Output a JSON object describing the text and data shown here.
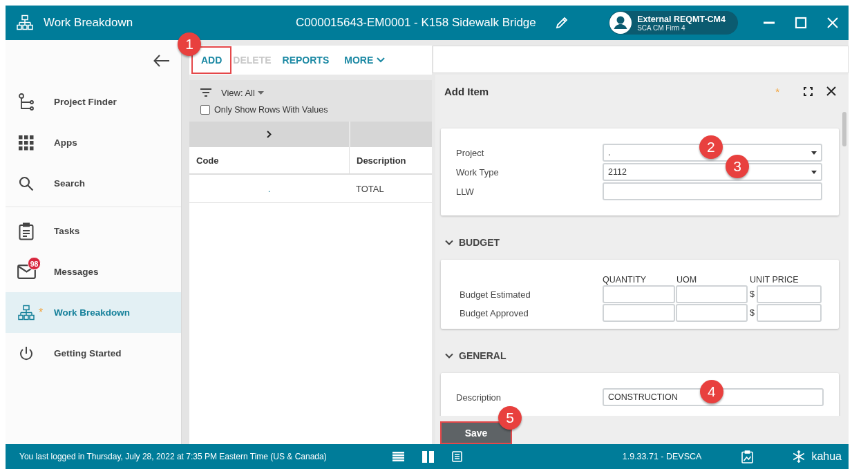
{
  "titlebar": {
    "app_name": "Work Breakdown",
    "title": "C000015643-EM0001 - K158 Sidewalk Bridge",
    "user": {
      "name": "External REQMT-CM4",
      "org": "SCA CM Firm 4"
    }
  },
  "sidebar": {
    "sections": [
      {
        "items": [
          {
            "label": "Project Finder",
            "kind": "tree",
            "selected": false
          },
          {
            "label": "Apps",
            "kind": "grid",
            "selected": false
          },
          {
            "label": "Search",
            "kind": "search",
            "selected": false
          }
        ]
      },
      {
        "items": [
          {
            "label": "Tasks",
            "kind": "clipboard",
            "selected": false
          },
          {
            "label": "Messages",
            "kind": "mail",
            "badge": "98",
            "selected": false
          },
          {
            "label": "Work Breakdown",
            "kind": "hierarchy",
            "marker": "*",
            "selected": true
          },
          {
            "label": "Getting Started",
            "kind": "power",
            "selected": false
          }
        ]
      }
    ]
  },
  "toolbar": [
    {
      "label": "ADD",
      "kind": "action",
      "disabled": false,
      "highlighted": true,
      "callout": "1"
    },
    {
      "label": "DELETE",
      "kind": "action",
      "disabled": true,
      "highlighted": false
    },
    {
      "label": "REPORTS",
      "kind": "action",
      "disabled": false,
      "highlighted": false
    },
    {
      "label": "MORE",
      "kind": "menu",
      "disabled": false,
      "highlighted": false
    }
  ],
  "grid": {
    "view": "View: All",
    "filter": {
      "label": "Only Show Rows With Values",
      "checked": false
    },
    "columns": [
      "Code",
      "Description"
    ],
    "rows": [
      {
        "code": ".",
        "description": "TOTAL"
      }
    ]
  },
  "form": {
    "title": "Add Item",
    "marker": "*",
    "fields": [
      {
        "label": "Project",
        "kind": "select",
        "value": ".",
        "callout": "2"
      },
      {
        "label": "Work Type",
        "kind": "select",
        "value": "2112",
        "callout": "3"
      },
      {
        "label": "LLW",
        "kind": "text"
      }
    ],
    "sections": [
      {
        "title": "BUDGET",
        "kind": "budget",
        "expanded": true,
        "columns": [
          "QUANTITY",
          "UOM",
          "UNIT PRICE"
        ],
        "rows": [
          {
            "label": "Budget Estimated",
            "currency": "$"
          },
          {
            "label": "Budget Approved",
            "currency": "$"
          }
        ]
      },
      {
        "title": "GENERAL",
        "kind": "fields",
        "expanded": true,
        "fields": [
          {
            "label": "Description",
            "kind": "text",
            "value": "CONSTRUCTION",
            "callout": "4"
          }
        ]
      }
    ],
    "save": {
      "label": "Save",
      "highlighted": true,
      "callout": "5"
    }
  },
  "status_bar": {
    "message": "You last logged in Thursday, July 28, 2022 at 7:35 PM Eastern Time (US & Canada)",
    "version": "1.9.33.71 - DEVSCA",
    "brand": "kahua"
  }
}
